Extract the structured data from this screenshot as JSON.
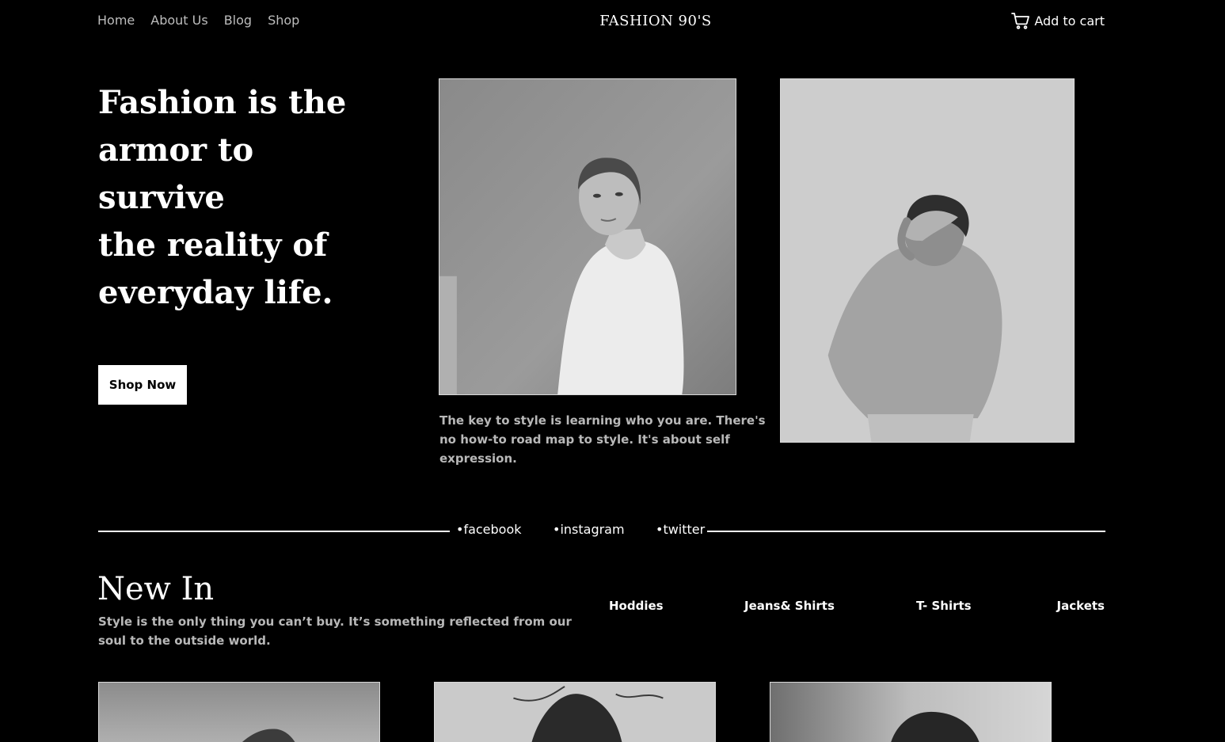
{
  "header": {
    "nav": [
      {
        "label": "Home"
      },
      {
        "label": "About Us"
      },
      {
        "label": "Blog"
      },
      {
        "label": "Shop"
      }
    ],
    "brand": "FASHION 90'S",
    "cart_label": "Add to cart",
    "cart_icon": "shopping-cart-icon"
  },
  "hero": {
    "title_lines": [
      "Fashion is the",
      "armor to survive",
      "the reality of",
      "everyday life."
    ],
    "cta_label": "Shop Now",
    "quote": "The key to style is learning who you are. There's no how-to road map to style. It's about self expression."
  },
  "social": [
    {
      "label": "•facebook"
    },
    {
      "label": "•instagram"
    },
    {
      "label": "•twitter"
    }
  ],
  "new_in": {
    "title": "New In",
    "subtitle": "Style is the only thing you can’t buy. It’s something reflected from our soul to the outside world.",
    "categories": [
      {
        "label": "Hoddies"
      },
      {
        "label": "Jeans& Shirts"
      },
      {
        "label": "T- Shirts"
      },
      {
        "label": "Jackets"
      }
    ]
  },
  "colors": {
    "background": "#000000",
    "text": "#ffffff",
    "muted_text": "#b8b8b8",
    "nav_text": "#bdbdbd",
    "button_bg": "#ffffff"
  }
}
